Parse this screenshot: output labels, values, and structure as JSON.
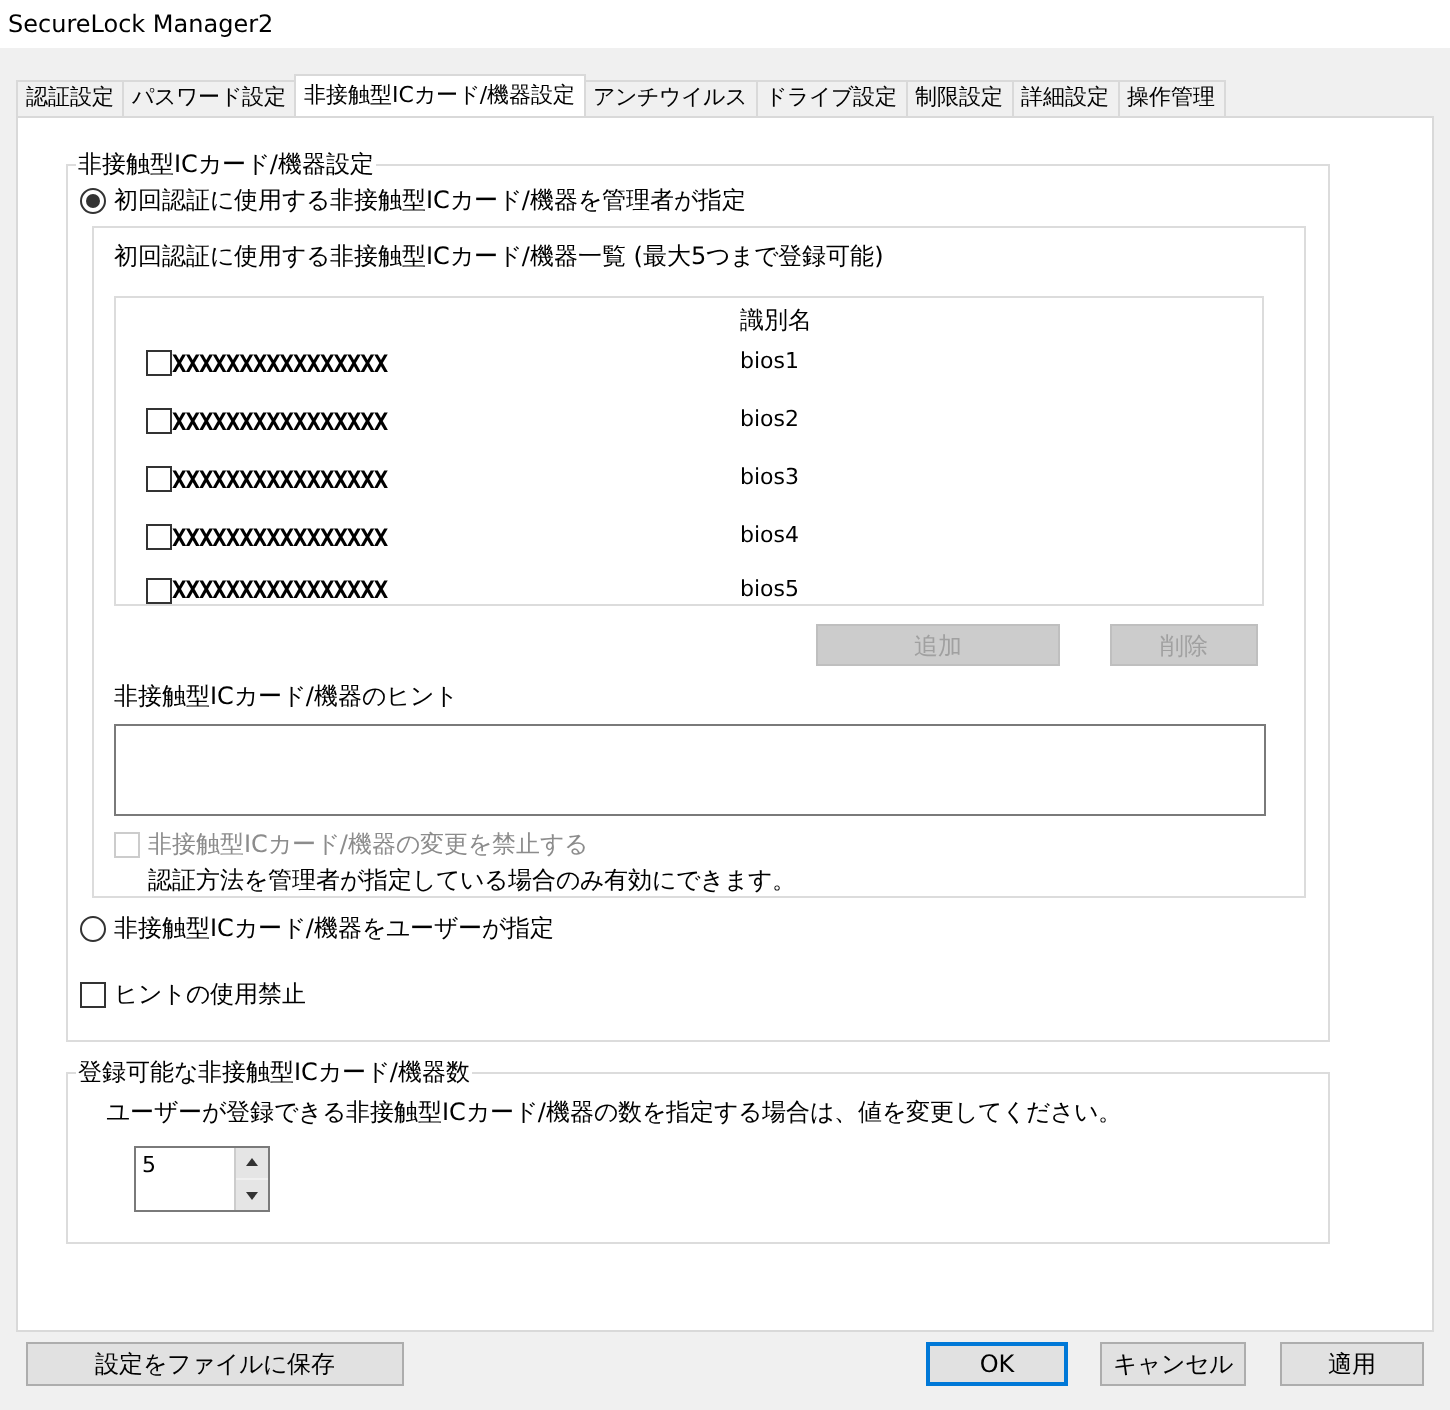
{
  "window": {
    "title": "SecureLock Manager2"
  },
  "tabs": [
    {
      "label": "認証設定",
      "selected": false
    },
    {
      "label": "パスワード設定",
      "selected": false
    },
    {
      "label": "非接触型ICカード/機器設定",
      "selected": true
    },
    {
      "label": "アンチウイルス",
      "selected": false
    },
    {
      "label": "ドライブ設定",
      "selected": false
    },
    {
      "label": "制限設定",
      "selected": false
    },
    {
      "label": "詳細設定",
      "selected": false
    },
    {
      "label": "操作管理",
      "selected": false
    }
  ],
  "settings_group": {
    "legend": "非接触型ICカード/機器設定",
    "admin_option": {
      "label": "初回認証に使用する非接触型ICカード/機器を管理者が指定",
      "selected": true
    },
    "device_panel": {
      "caption": "初回認証に使用する非接触型ICカード/機器一覧 (最大5つまで登録可能)",
      "column_header": "識別名",
      "devices": [
        {
          "id": "XXXXXXXXXXXXXXXX",
          "name": "bios1",
          "checked": false
        },
        {
          "id": "XXXXXXXXXXXXXXXX",
          "name": "bios2",
          "checked": false
        },
        {
          "id": "XXXXXXXXXXXXXXXX",
          "name": "bios3",
          "checked": false
        },
        {
          "id": "XXXXXXXXXXXXXXXX",
          "name": "bios4",
          "checked": false
        },
        {
          "id": "XXXXXXXXXXXXXXXX",
          "name": "bios5",
          "checked": false
        }
      ],
      "add_button": {
        "label": "追加",
        "disabled": true
      },
      "delete_button": {
        "label": "削除",
        "disabled": true
      },
      "hint_label": "非接触型ICカード/機器のヒント",
      "lock_option": {
        "label": "非接触型ICカード/機器の変更を禁止する",
        "checked": false,
        "disabled": true
      },
      "note": "認証方法を管理者が指定している場合のみ有効にできます。"
    },
    "user_option": {
      "label": "非接触型ICカード/機器をユーザーが指定",
      "selected": false
    },
    "disable_hint": {
      "label": "ヒントの使用禁止",
      "checked": false
    }
  },
  "count_group": {
    "legend": "登録可能な非接触型ICカード/機器数",
    "description": "ユーザーが登録できる非接触型ICカード/機器の数を指定する場合は、値を変更してください。",
    "spinner": {
      "value": "5"
    }
  },
  "save_button": {
    "label": "設定をファイルに保存"
  },
  "buttons": [
    {
      "label": "OK",
      "default": true
    },
    {
      "label": "キャンセル",
      "default": false
    },
    {
      "label": "適用",
      "default": false
    }
  ]
}
